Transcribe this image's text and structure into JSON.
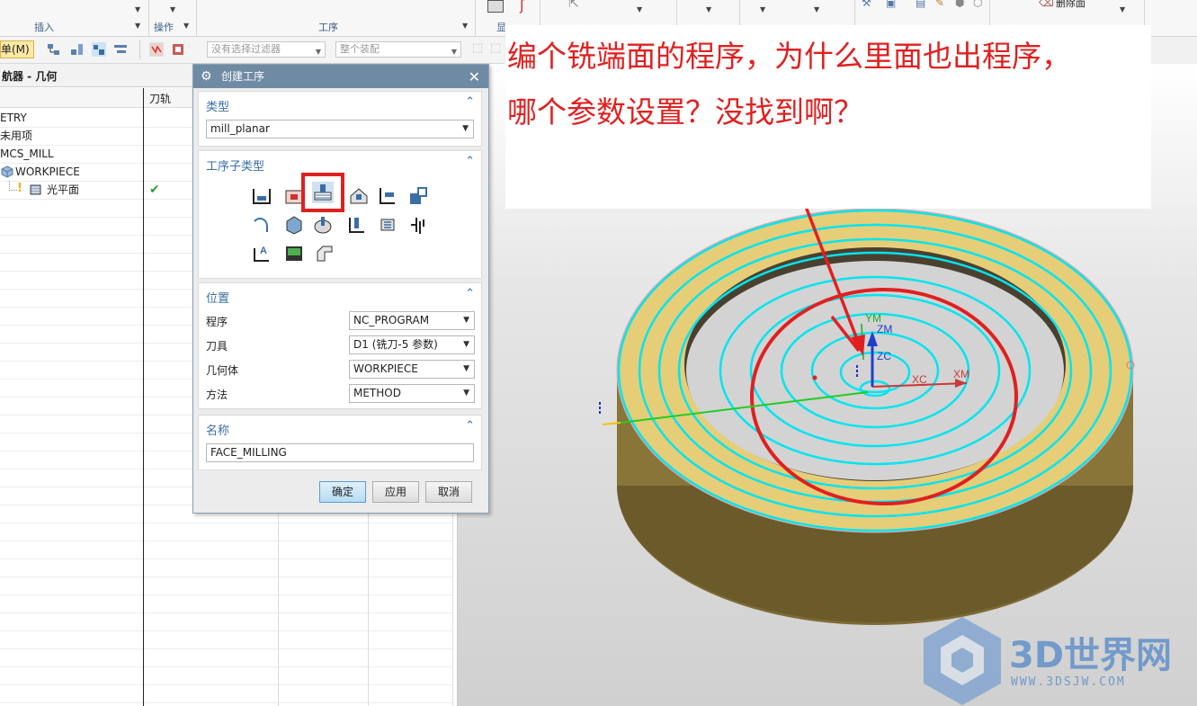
{
  "ribbon": {
    "groups": [
      "插入",
      "操作",
      "工序",
      "显"
    ],
    "right_button_label": "删除面"
  },
  "toolbar": {
    "menu_button_label": "单(M)",
    "filter_placeholder": "没有选择过滤器",
    "assembly_placeholder": "整个装配"
  },
  "navigator": {
    "title": "航器 - 几何",
    "col_toolpath": "刀轨",
    "tree": [
      {
        "label": "ETRY",
        "indent": 0
      },
      {
        "label": "未用项",
        "indent": 0
      },
      {
        "label": "MCS_MILL",
        "indent": 0
      },
      {
        "label": "WORKPIECE",
        "indent": 1
      },
      {
        "label": "光平面",
        "indent": 2,
        "toolpath_ok": "✔"
      }
    ]
  },
  "dialog": {
    "title": "创建工序",
    "type_section": {
      "title": "类型",
      "value": "mill_planar"
    },
    "subtype_section": {
      "title": "工序子类型"
    },
    "location_section": {
      "title": "位置",
      "fields": [
        {
          "label": "程序",
          "value": "NC_PROGRAM"
        },
        {
          "label": "刀具",
          "value": "D1 (铣刀-5 参数)"
        },
        {
          "label": "几何体",
          "value": "WORKPIECE"
        },
        {
          "label": "方法",
          "value": "METHOD"
        }
      ]
    },
    "name_section": {
      "title": "名称",
      "value": "FACE_MILLING"
    },
    "buttons": {
      "ok": "确定",
      "apply": "应用",
      "cancel": "取消"
    }
  },
  "annotation": {
    "line1": "编个铣端面的程序，为什么里面也出程序，",
    "line2": "哪个参数设置？没找到啊？"
  },
  "axes_labels": {
    "ym": "YM",
    "zm": "ZM",
    "zc": "ZC",
    "xc": "XC",
    "xm": "XM"
  },
  "watermark": {
    "brand": "3D世界网",
    "url": "WWW.3DSJW.COM"
  },
  "colors": {
    "annotation_red": "#e02020",
    "toolpath_cyan": "#00e5f0",
    "part_top": "#e6cd78",
    "dialog_title": "#6f8aa3",
    "section_title": "#3a6ea5"
  }
}
